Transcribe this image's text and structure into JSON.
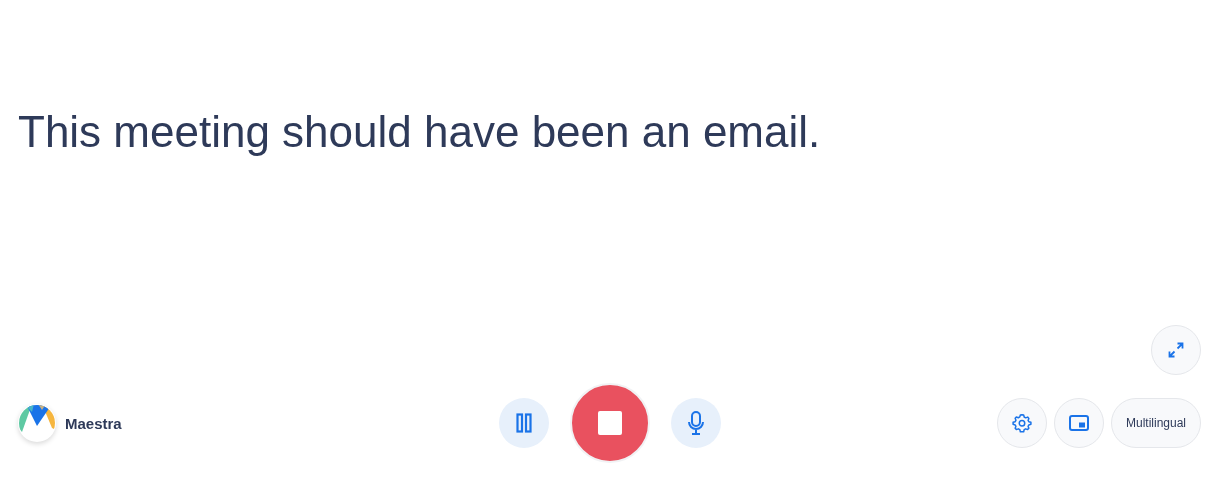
{
  "caption": "This meeting should have been an email.",
  "brand": {
    "name": "Maestra"
  },
  "top_controls": [
    {
      "kind": "expand"
    }
  ],
  "center_controls": [
    {
      "kind": "pause"
    },
    {
      "kind": "stop"
    },
    {
      "kind": "mic"
    }
  ],
  "right_controls": [
    {
      "kind": "settings"
    },
    {
      "kind": "pip"
    },
    {
      "kind": "text",
      "label": "Multilingual"
    }
  ]
}
